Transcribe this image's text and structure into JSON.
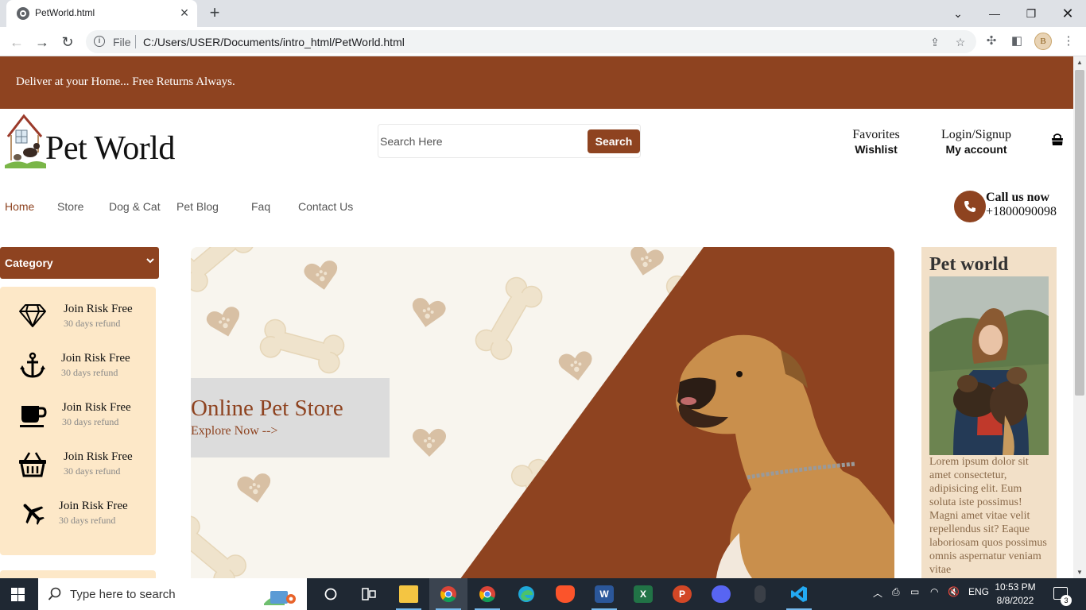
{
  "browser": {
    "tab_title": "PetWorld.html",
    "new_tab": "+",
    "address_scheme_label": "File",
    "url": "C:/Users/USER/Documents/intro_html/PetWorld.html",
    "profile_initial": "B"
  },
  "page": {
    "promo_text": "Deliver at your Home... Free Returns Always.",
    "logo_text": "Pet World",
    "search": {
      "placeholder": "Search Here",
      "button_label": "Search"
    },
    "header_links": [
      {
        "top": "Favorites",
        "bottom": "Wishlist"
      },
      {
        "top": "Login/Signup",
        "bottom": "My account"
      }
    ],
    "nav": [
      "Home",
      "Store",
      "Dog & Cat",
      "Pet Blog",
      "Faq",
      "Contact Us"
    ],
    "call": {
      "title": "Call us now",
      "number": "+1800090098"
    },
    "category_label": "Category",
    "features": [
      {
        "icon": "diamond-icon",
        "title": "Join Risk Free",
        "subtitle": "30 days refund"
      },
      {
        "icon": "anchor-icon",
        "title": "Join Risk Free",
        "subtitle": "30 days refund"
      },
      {
        "icon": "coffee-cup-icon",
        "title": "Join Risk Free",
        "subtitle": "30 days refund"
      },
      {
        "icon": "basket-icon",
        "title": "Join Risk Free",
        "subtitle": "30 days refund"
      },
      {
        "icon": "plane-icon",
        "title": "Join Risk Free",
        "subtitle": "30 days refund"
      }
    ],
    "hero": {
      "title": "Online Pet Store",
      "link": "Explore Now -->"
    },
    "aside": {
      "title": "Pet world",
      "text": "Lorem ipsum dolor sit amet consectetur, adipisicing elit. Eum soluta iste possimus! Magni amet vitae velit repellendus sit? Eaque laboriosam quos possimus omnis aspernatur veniam vitae"
    },
    "colors": {
      "brand": "#8e4320",
      "feature_bg": "#fde8c8",
      "aside_bg": "#f2e0c8"
    }
  },
  "taskbar": {
    "search_placeholder": "Type here to search",
    "apps": [
      "file-explorer",
      "chrome",
      "chrome",
      "edge",
      "brave",
      "word",
      "excel",
      "powerpoint",
      "discord",
      "mouse",
      "vscode"
    ],
    "language": "ENG",
    "time": "10:53 PM",
    "date": "8/8/2022",
    "notification_count": "3"
  }
}
